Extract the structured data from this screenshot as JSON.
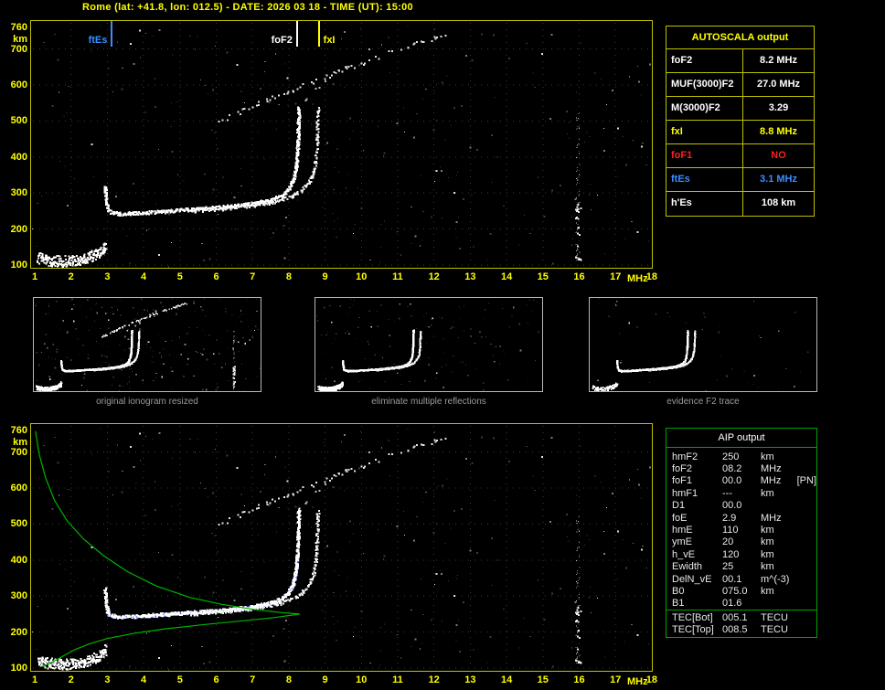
{
  "title": "Rome (lat: +41.8, lon: 012.5) - DATE: 2026 03 18 - TIME (UT): 15:00",
  "autoscala_table": {
    "header": "AUTOSCALA output",
    "rows": [
      {
        "label": "foF2",
        "value": "8.2 MHz",
        "color": "#ffffff"
      },
      {
        "label": "MUF(3000)F2",
        "value": "27.0 MHz",
        "color": "#ffffff"
      },
      {
        "label": "M(3000)F2",
        "value": "3.29",
        "color": "#ffffff"
      },
      {
        "label": "fxI",
        "value": "8.8 MHz",
        "color": "#ffff00"
      },
      {
        "label": "foF1",
        "value": "NO",
        "color": "#ff2020"
      },
      {
        "label": "ftEs",
        "value": "3.1 MHz",
        "color": "#3b8eff"
      },
      {
        "label": "h'Es",
        "value": "108  km",
        "color": "#ffffff"
      }
    ]
  },
  "aip_table": {
    "header": "AIP output",
    "rows": [
      {
        "label": "hmF2",
        "value": "250",
        "unit": "km"
      },
      {
        "label": "foF2",
        "value": "08.2",
        "unit": "MHz"
      },
      {
        "label": "foF1",
        "value": "00.0",
        "unit": "MHz",
        "extra": "[PN]"
      },
      {
        "label": "hmF1",
        "value": "---",
        "unit": "km"
      },
      {
        "label": "D1",
        "value": "00.0",
        "unit": ""
      },
      {
        "label": "foE",
        "value": "2.9",
        "unit": "MHz"
      },
      {
        "label": "hmE",
        "value": "110",
        "unit": "km"
      },
      {
        "label": "ymE",
        "value": "20",
        "unit": "km"
      },
      {
        "label": "h_vE",
        "value": "120",
        "unit": "km"
      },
      {
        "label": "Ewidth",
        "value": "25",
        "unit": "km"
      },
      {
        "label": "DelN_vE",
        "value": "00.1",
        "unit": "m^(-3)"
      },
      {
        "label": "B0",
        "value": "075.0",
        "unit": "km"
      },
      {
        "label": "B1",
        "value": "01.6",
        "unit": ""
      }
    ],
    "tec_rows": [
      {
        "label": "TEC[Bot]",
        "value": "005.1",
        "unit": "TECU"
      },
      {
        "label": "TEC[Top]",
        "value": "008.5",
        "unit": "TECU"
      }
    ]
  },
  "thumbnails": [
    {
      "caption": "original ionogram resized"
    },
    {
      "caption": "eliminate multiple reflections"
    },
    {
      "caption": "evidence F2 trace"
    }
  ],
  "markers": [
    {
      "label": "ftEs",
      "freq": 3.1,
      "color": "#3b8eff",
      "side": "left"
    },
    {
      "label": "foF2",
      "freq": 8.2,
      "color": "#ffffff",
      "side": "left"
    },
    {
      "label": "fxI",
      "freq": 8.8,
      "color": "#ffff00",
      "side": "right"
    }
  ],
  "chart_data": {
    "type": "scatter",
    "title": "Ionogram - Rome 2026-03-18 15:00 UT",
    "x_axis": {
      "label": "MHz",
      "min": 1,
      "max": 18,
      "ticks": [
        1,
        2,
        3,
        4,
        5,
        6,
        7,
        8,
        9,
        10,
        11,
        12,
        13,
        14,
        15,
        16,
        17,
        18
      ]
    },
    "y_axis": {
      "label": "km",
      "min": 100,
      "max": 760,
      "ticks": [
        760,
        700,
        600,
        500,
        400,
        300,
        200,
        100
      ]
    },
    "grid": "dotted",
    "scaled_parameters": {
      "foF2_MHz": 8.2,
      "MUF3000F2_MHz": 27.0,
      "M3000F2": 3.29,
      "fxI_MHz": 8.8,
      "foF1": "NO",
      "ftEs_MHz": 3.1,
      "hEs_km": 108,
      "hmF2_km": 250
    },
    "traces": {
      "es_layer": [
        [
          1.08,
          122
        ],
        [
          1.35,
          115
        ],
        [
          1.7,
          112
        ],
        [
          2.1,
          114
        ],
        [
          2.45,
          122
        ],
        [
          2.7,
          132
        ],
        [
          2.85,
          143
        ],
        [
          2.95,
          156
        ]
      ],
      "f2_ordinary": [
        [
          2.92,
          320
        ],
        [
          2.96,
          275
        ],
        [
          3.02,
          252
        ],
        [
          3.25,
          244
        ],
        [
          3.8,
          246
        ],
        [
          4.6,
          251
        ],
        [
          5.4,
          257
        ],
        [
          6.2,
          263
        ],
        [
          6.9,
          271
        ],
        [
          7.45,
          281
        ],
        [
          7.8,
          295
        ],
        [
          8.0,
          313
        ],
        [
          8.12,
          340
        ],
        [
          8.19,
          378
        ],
        [
          8.23,
          430
        ],
        [
          8.25,
          490
        ],
        [
          8.26,
          545
        ]
      ],
      "f2_extraordinary": [
        [
          5.3,
          251
        ],
        [
          6.0,
          257
        ],
        [
          6.7,
          264
        ],
        [
          7.3,
          272
        ],
        [
          7.75,
          281
        ],
        [
          8.1,
          294
        ],
        [
          8.35,
          310
        ],
        [
          8.55,
          333
        ],
        [
          8.68,
          365
        ],
        [
          8.74,
          410
        ],
        [
          8.77,
          465
        ],
        [
          8.79,
          540
        ]
      ],
      "second_reflection": [
        [
          5.95,
          492
        ],
        [
          6.6,
          525
        ],
        [
          7.3,
          556
        ],
        [
          8.0,
          586
        ],
        [
          8.7,
          614
        ],
        [
          9.4,
          641
        ],
        [
          10.1,
          667
        ],
        [
          10.8,
          693
        ],
        [
          11.6,
          719
        ],
        [
          12.4,
          744
        ]
      ],
      "second_reflection_upper": [
        [
          8.35,
          560
        ],
        [
          8.9,
          605
        ],
        [
          9.6,
          655
        ],
        [
          10.3,
          705
        ]
      ],
      "noise_column_mhz": 15.95
    },
    "profile": [
      [
        1.02,
        758
      ],
      [
        1.12,
        695
      ],
      [
        1.3,
        628
      ],
      [
        1.55,
        565
      ],
      [
        1.9,
        508
      ],
      [
        2.35,
        458
      ],
      [
        2.9,
        412
      ],
      [
        3.55,
        368
      ],
      [
        4.35,
        328
      ],
      [
        5.25,
        297
      ],
      [
        6.15,
        277
      ],
      [
        7.1,
        262
      ],
      [
        7.8,
        254
      ],
      [
        8.3,
        250
      ],
      [
        7.6,
        240
      ],
      [
        6.6,
        230
      ],
      [
        5.6,
        220
      ],
      [
        4.6,
        209
      ],
      [
        3.7,
        196
      ],
      [
        3.0,
        182
      ],
      [
        2.5,
        167
      ],
      [
        2.1,
        151
      ],
      [
        1.85,
        137
      ],
      [
        1.65,
        126
      ],
      [
        1.48,
        117
      ],
      [
        1.32,
        109
      ],
      [
        1.18,
        104
      ]
    ],
    "fitted_trace": [
      [
        2.98,
        258
      ],
      [
        3.05,
        247
      ],
      [
        3.3,
        243
      ],
      [
        3.8,
        245
      ],
      [
        4.6,
        250
      ],
      [
        5.4,
        256
      ],
      [
        6.2,
        262
      ],
      [
        6.9,
        270
      ],
      [
        7.45,
        280
      ],
      [
        7.8,
        294
      ],
      [
        8.0,
        312
      ],
      [
        8.12,
        339
      ],
      [
        8.19,
        376
      ],
      [
        8.22,
        415
      ]
    ]
  }
}
